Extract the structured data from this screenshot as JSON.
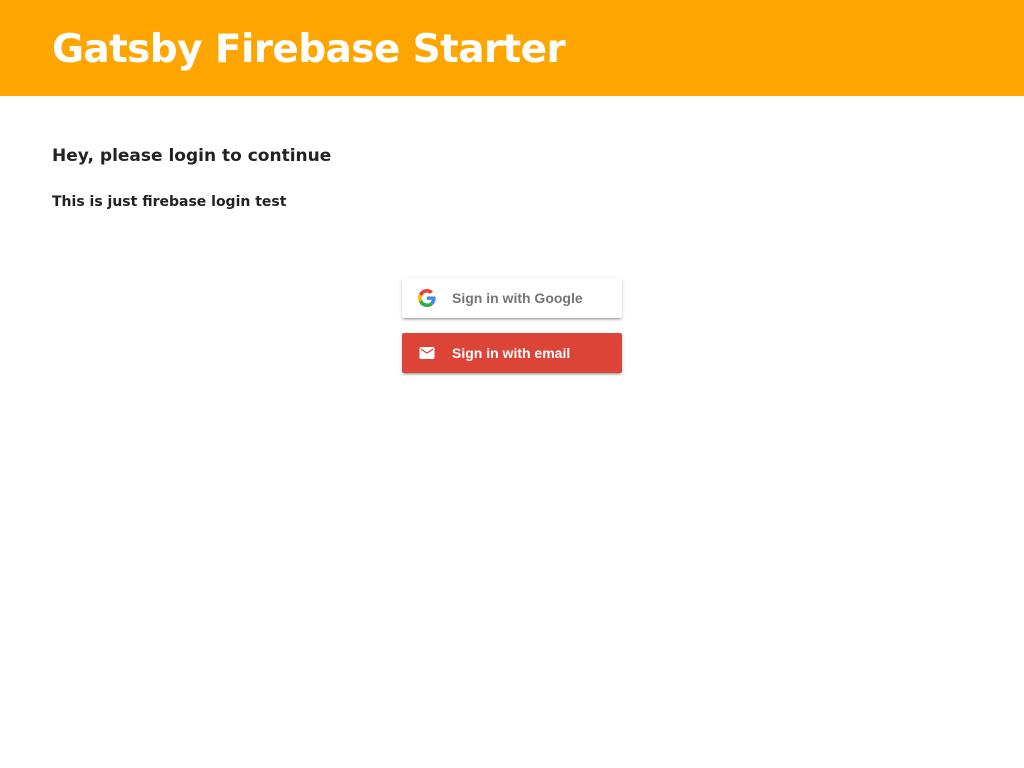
{
  "header": {
    "title": "Gatsby Firebase Starter",
    "background_color": "#ffa500"
  },
  "main": {
    "heading": "Hey, please login to continue",
    "subheading": "This is just firebase login test"
  },
  "auth": {
    "providers": [
      {
        "label": "Sign in with Google",
        "icon": "google-g-icon",
        "background_color": "#ffffff",
        "text_color": "#757575"
      },
      {
        "label": "Sign in with email",
        "icon": "mail-icon",
        "background_color": "#db4437",
        "text_color": "#ffffff"
      }
    ]
  }
}
